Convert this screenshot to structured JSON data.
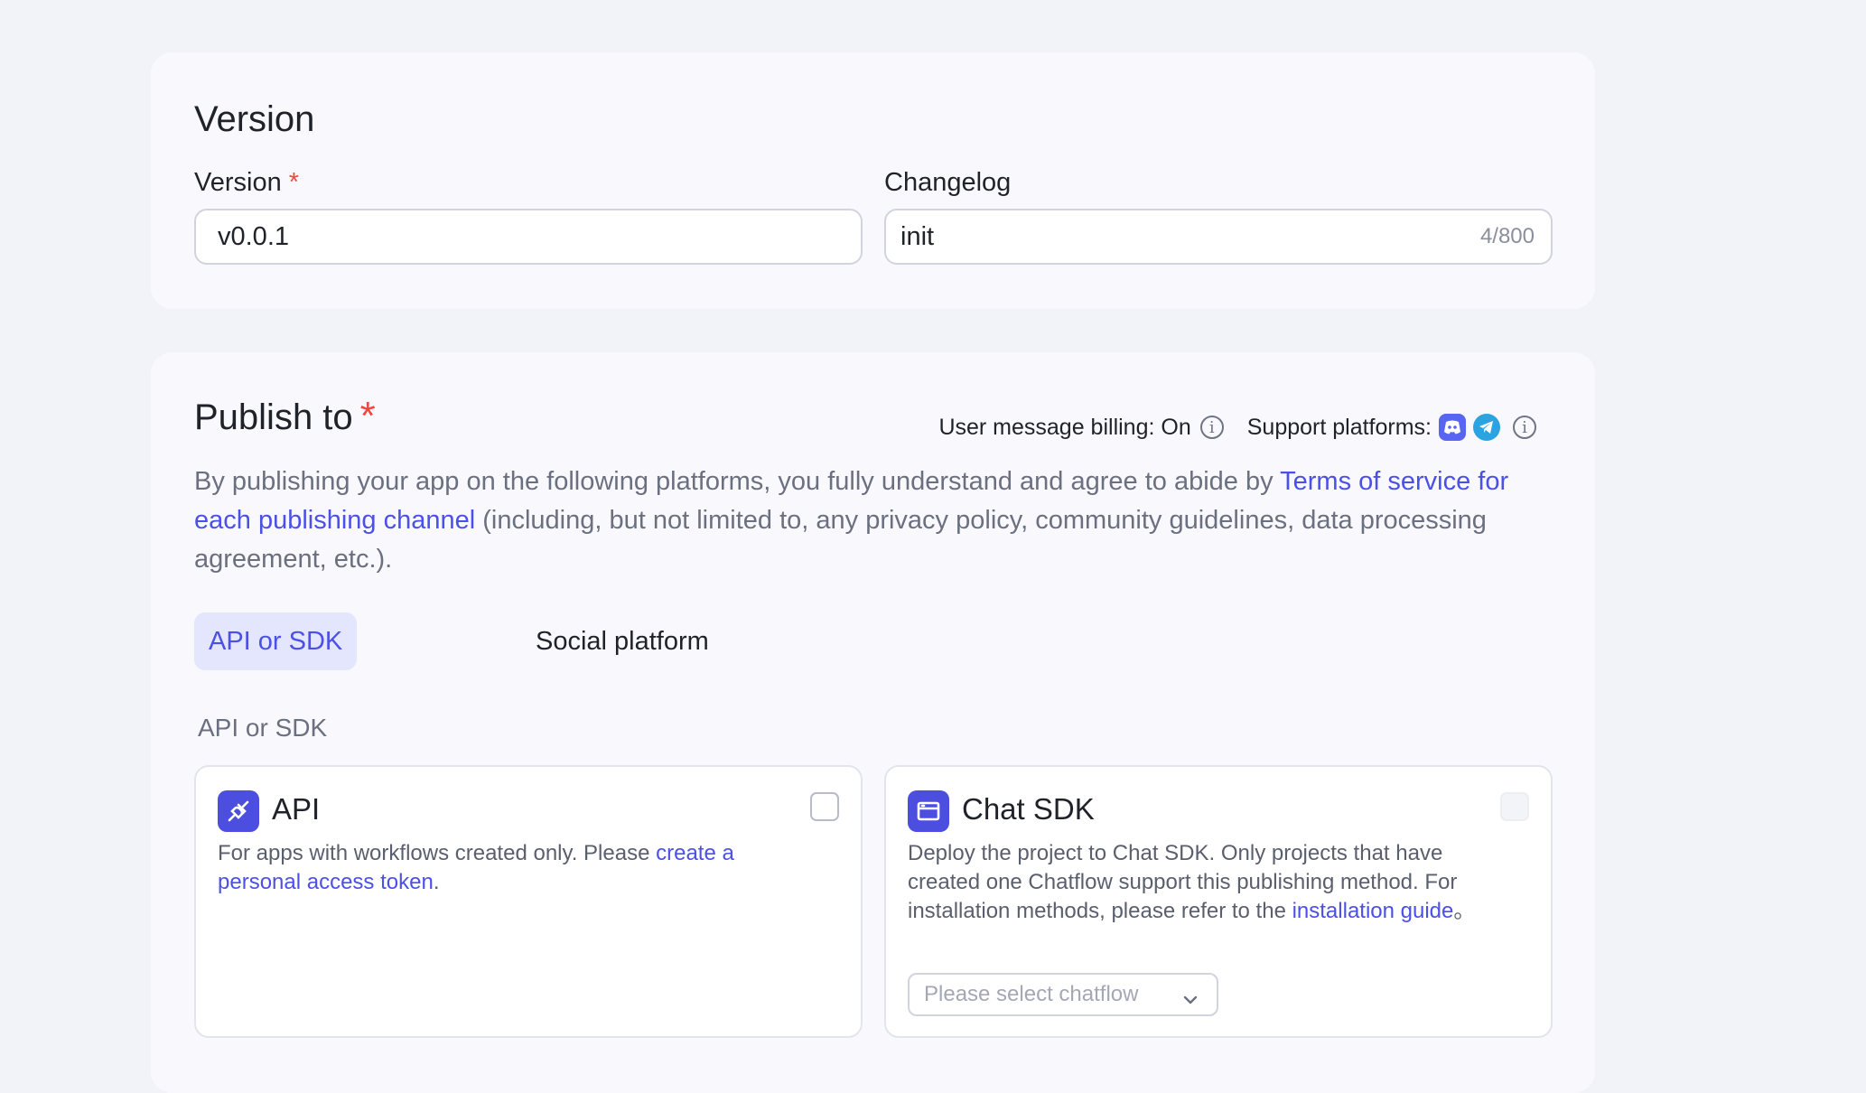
{
  "version_section": {
    "title": "Version",
    "version_label": "Version",
    "required_mark": "*",
    "version_value": "v0.0.1",
    "changelog_label": "Changelog",
    "changelog_value": "init",
    "changelog_counter": "4/800"
  },
  "publish_section": {
    "title": "Publish to",
    "required_mark": "*",
    "billing_text": "User message billing: On",
    "support_text": "Support platforms:",
    "platform_icons": [
      "discord-icon",
      "telegram-icon"
    ],
    "desc_prefix": "By publishing your app on the following platforms, you fully understand and agree to abide by ",
    "desc_link": "Terms of service for each publishing channel",
    "desc_suffix": " (including, but not limited to, any privacy policy, community guidelines, data processing agreement, etc.).",
    "tabs": [
      {
        "label": "API or SDK",
        "active": true
      },
      {
        "label": "Social platform",
        "active": false
      }
    ],
    "group_label": "API or SDK",
    "options": {
      "api": {
        "title": "API",
        "icon": "api-link-icon",
        "desc_prefix": "For apps with workflows created only. Please ",
        "desc_link": "create a personal access token",
        "desc_suffix": ".",
        "checked": false
      },
      "chat_sdk": {
        "title": "Chat SDK",
        "icon": "browser-window-icon",
        "desc_prefix": "Deploy the project to Chat SDK. Only projects that have created one Chatflow support this publishing method. For installation methods, please refer to the ",
        "desc_link": "installation guide",
        "desc_suffix": "。",
        "select_placeholder": "Please select chatflow",
        "checked": false,
        "disabled": true
      }
    }
  },
  "colors": {
    "accent": "#4b50e6",
    "required": "#f0483e",
    "page_bg": "#f2f3f8",
    "card_bg": "#f9f9fd"
  }
}
